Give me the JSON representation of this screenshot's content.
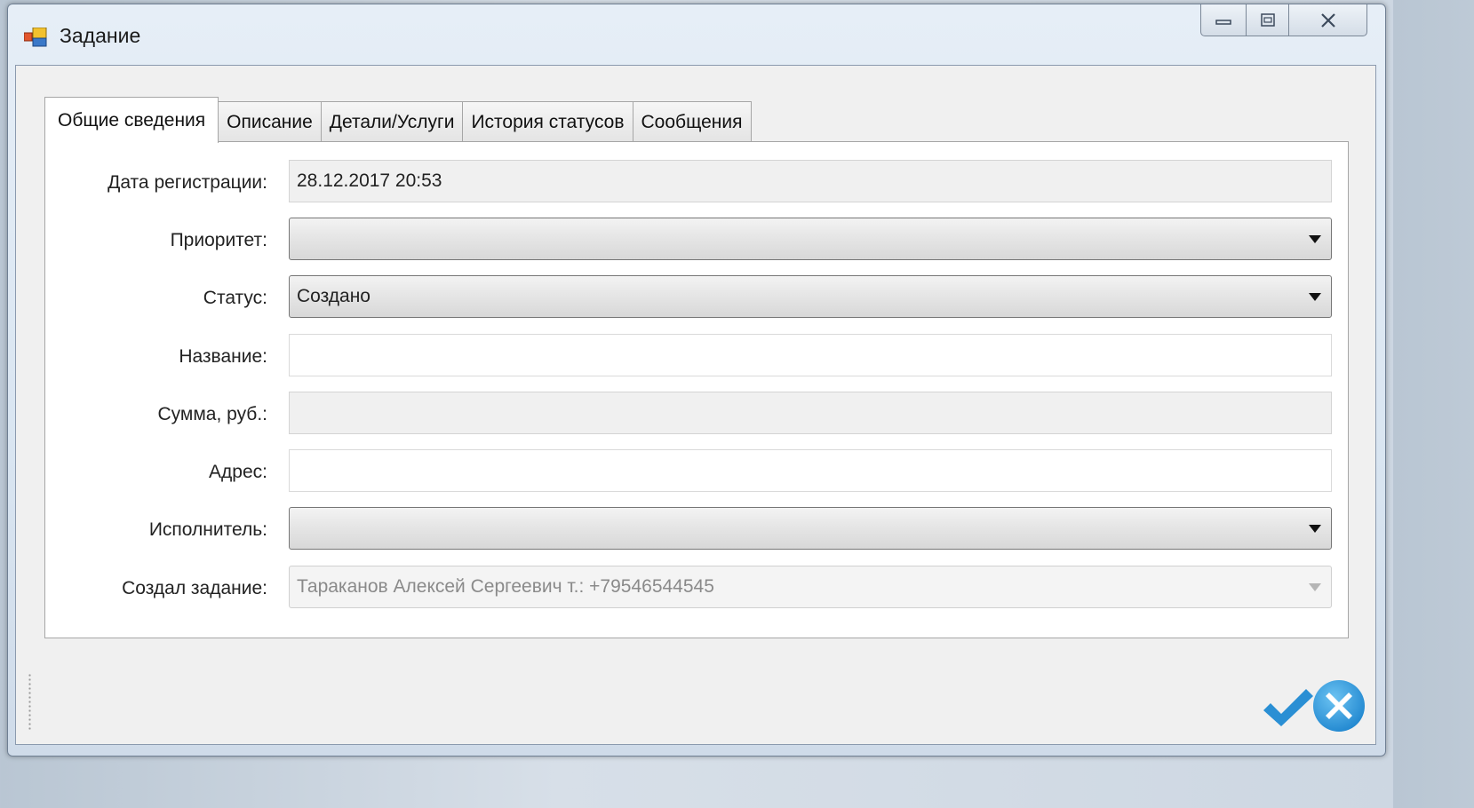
{
  "window": {
    "title": "Задание",
    "icon": "app-window-icon",
    "controls": [
      "minimize-icon",
      "maximize-icon",
      "close-icon"
    ]
  },
  "tabs": [
    {
      "label": "Общие сведения",
      "active": true
    },
    {
      "label": "Описание",
      "active": false
    },
    {
      "label": "Детали/Услуги",
      "active": false
    },
    {
      "label": "История статусов",
      "active": false
    },
    {
      "label": "Сообщения",
      "active": false
    }
  ],
  "form": {
    "registration_date": {
      "label": "Дата регистрации:",
      "value": "28.12.2017 20:53"
    },
    "priority": {
      "label": "Приоритет:",
      "value": ""
    },
    "status": {
      "label": "Статус:",
      "value": "Создано"
    },
    "name": {
      "label": "Название:",
      "value": ""
    },
    "amount": {
      "label": "Сумма, руб.:",
      "value": ""
    },
    "address": {
      "label": "Адрес:",
      "value": ""
    },
    "executor": {
      "label": "Исполнитель:",
      "value": ""
    },
    "created_by": {
      "label": "Создал задание:",
      "value": "Тараканов Алексей Сергеевич т.: +79546544545"
    }
  },
  "actions": {
    "ok_icon": "checkmark-icon",
    "cancel_icon": "cancel-circle-icon"
  },
  "colors": {
    "accent_blue": "#2a8fd4",
    "window_frame": "#d9e5f1"
  }
}
